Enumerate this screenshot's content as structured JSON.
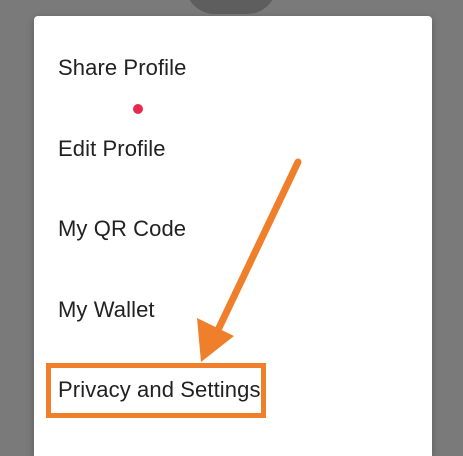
{
  "menu": {
    "items": [
      {
        "label": "Share Profile"
      },
      {
        "label": "Edit Profile"
      },
      {
        "label": "My QR Code"
      },
      {
        "label": "My Wallet"
      },
      {
        "label": "Privacy and Settings"
      }
    ]
  },
  "colors": {
    "annotation": "#f07f2b",
    "notification_dot": "#e8294f",
    "menu_background": "#ffffff",
    "overlay": "#7a7a7a"
  },
  "annotation": {
    "highlighted_item": "Privacy and Settings",
    "pointer_icon": "arrow-icon"
  }
}
